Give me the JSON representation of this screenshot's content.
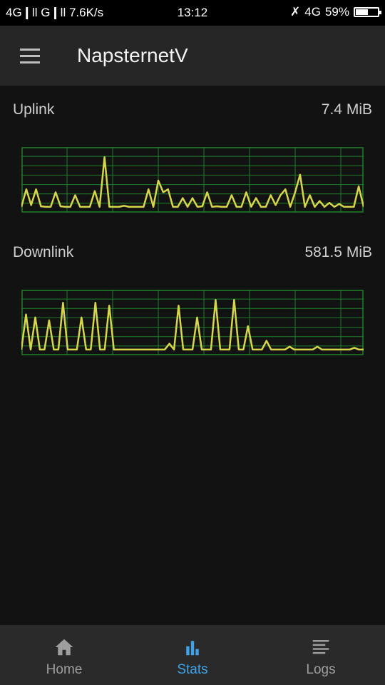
{
  "status_bar": {
    "network": "4G❙ll G❙ll 7.6K/s",
    "time": "13:12",
    "indicators": "4G",
    "battery_percent": "59%",
    "battery_level": 0.59
  },
  "app_bar": {
    "title": "NapsternetV",
    "menu_icon": "hamburger-menu-icon"
  },
  "stats": {
    "uplink": {
      "label": "Uplink",
      "value": "7.4 MiB"
    },
    "downlink": {
      "label": "Downlink",
      "value": "581.5 MiB"
    }
  },
  "bottom_nav": {
    "items": [
      {
        "label": "Home",
        "icon": "home-icon"
      },
      {
        "label": "Stats",
        "icon": "bar-chart-icon"
      },
      {
        "label": "Logs",
        "icon": "list-icon"
      }
    ],
    "active": "Stats"
  },
  "colors": {
    "background": "#121212",
    "app_bar": "#262626",
    "accent": "#3ea3e8",
    "graph_line": "#d7d64b",
    "graph_grid": "#1e7f2a"
  },
  "chart_data": [
    {
      "type": "line",
      "title": "",
      "series": [
        {
          "values": [
            0.05,
            0.35,
            0.08,
            0.35,
            0.06,
            0.05,
            0.05,
            0.3,
            0.06,
            0.05,
            0.05,
            0.25,
            0.05,
            0.05,
            0.05,
            0.32,
            0.05,
            0.9,
            0.05,
            0.05,
            0.05,
            0.07,
            0.05,
            0.05,
            0.05,
            0.05,
            0.35,
            0.05,
            0.5,
            0.3,
            0.35,
            0.05,
            0.05,
            0.2,
            0.05,
            0.2,
            0.05,
            0.06,
            0.3,
            0.05,
            0.06,
            0.05,
            0.05,
            0.25,
            0.05,
            0.05,
            0.3,
            0.05,
            0.2,
            0.05,
            0.05,
            0.25,
            0.08,
            0.25,
            0.35,
            0.05,
            0.3,
            0.6,
            0.05,
            0.25,
            0.05,
            0.15,
            0.05,
            0.12,
            0.05,
            0.1,
            0.05,
            0.05,
            0.05,
            0.4,
            0.05
          ]
        }
      ]
    },
    {
      "type": "line",
      "title": "",
      "series": [
        {
          "values": [
            0.05,
            0.65,
            0.05,
            0.6,
            0.05,
            0.05,
            0.55,
            0.05,
            0.05,
            0.85,
            0.05,
            0.05,
            0.05,
            0.6,
            0.05,
            0.05,
            0.85,
            0.05,
            0.05,
            0.8,
            0.05,
            0.05,
            0.05,
            0.05,
            0.05,
            0.05,
            0.05,
            0.05,
            0.05,
            0.05,
            0.05,
            0.05,
            0.15,
            0.05,
            0.8,
            0.05,
            0.05,
            0.05,
            0.6,
            0.05,
            0.05,
            0.05,
            0.9,
            0.05,
            0.05,
            0.05,
            0.9,
            0.05,
            0.05,
            0.45,
            0.05,
            0.05,
            0.05,
            0.2,
            0.05,
            0.05,
            0.05,
            0.05,
            0.1,
            0.05,
            0.05,
            0.05,
            0.05,
            0.05,
            0.1,
            0.05,
            0.05,
            0.05,
            0.05,
            0.05,
            0.05,
            0.05,
            0.08,
            0.05,
            0.05
          ]
        }
      ]
    }
  ]
}
